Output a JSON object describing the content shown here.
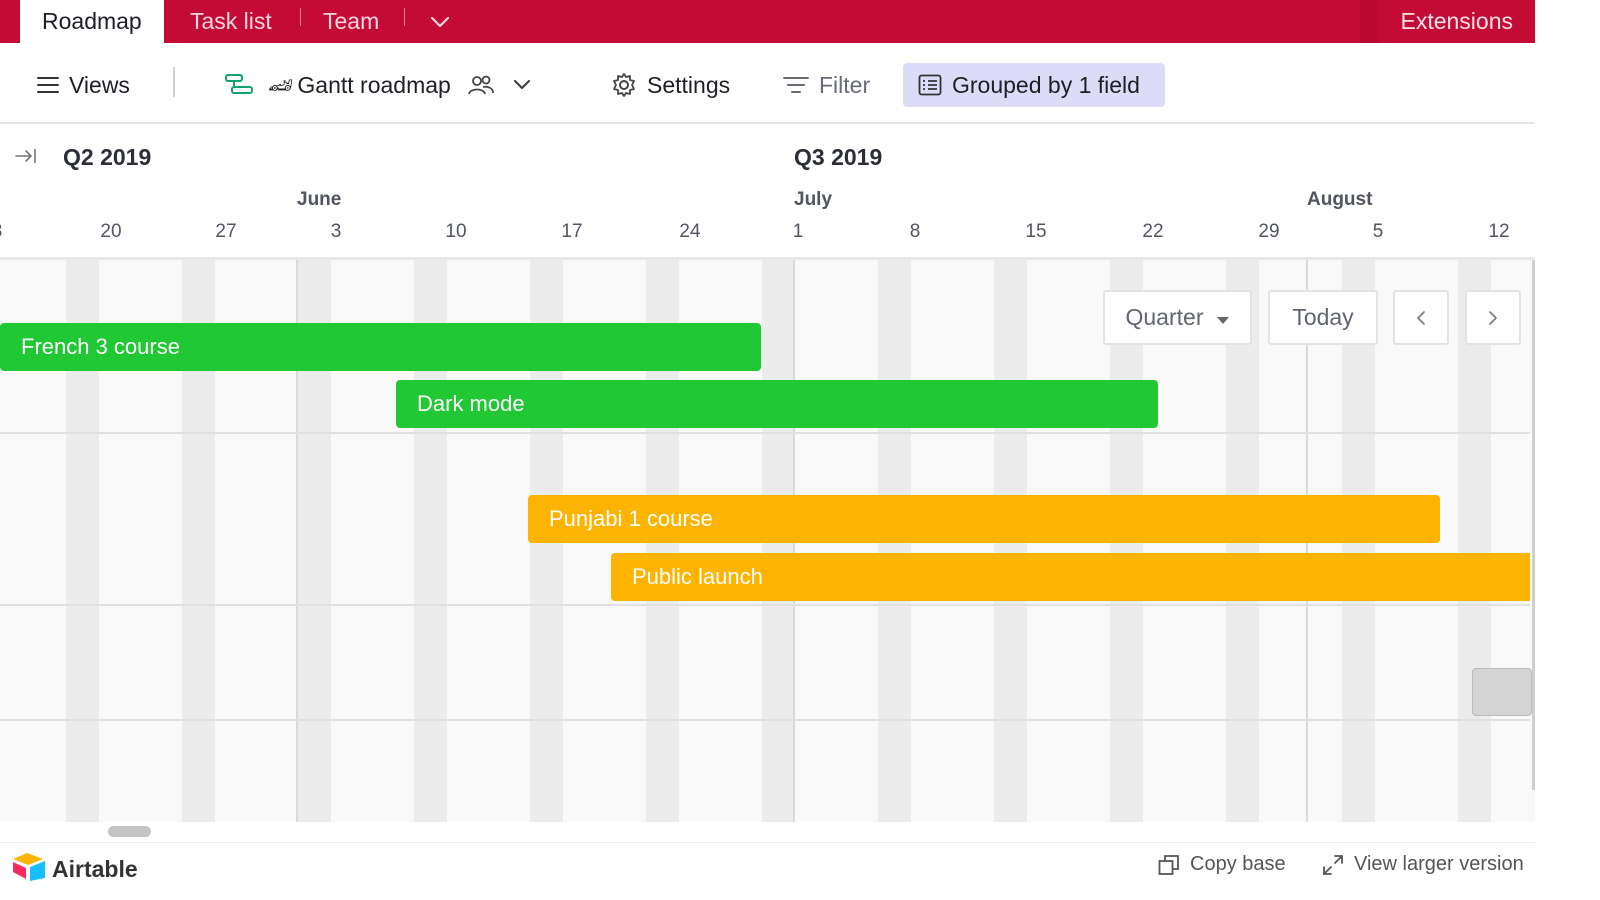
{
  "tabs": {
    "roadmap": "Roadmap",
    "task_list": "Task list",
    "team": "Team",
    "extensions": "Extensions"
  },
  "toolbar": {
    "views": "Views",
    "view_emoji": "🏎",
    "view_name": "Gantt roadmap",
    "settings": "Settings",
    "filter": "Filter",
    "grouped": "Grouped by 1 field"
  },
  "timeline": {
    "quarters": [
      "Q2 2019",
      "Q3 2019"
    ],
    "months": [
      "June",
      "July",
      "August"
    ],
    "days": [
      "3",
      "20",
      "27",
      "3",
      "10",
      "17",
      "24",
      "1",
      "8",
      "15",
      "22",
      "29",
      "5",
      "12"
    ]
  },
  "bars": [
    {
      "label": "French 3 course",
      "group": "green",
      "start": "2019-05-13",
      "end": "2019-06-30"
    },
    {
      "label": "Dark mode",
      "group": "green",
      "start": "2019-06-09",
      "end": "2019-07-27"
    },
    {
      "label": "Punjabi 1 course",
      "group": "orange",
      "start": "2019-06-18",
      "end": "2019-08-07"
    },
    {
      "label": "Public launch",
      "group": "orange",
      "start": "2019-06-23"
    }
  ],
  "controls": {
    "range": "Quarter",
    "today": "Today",
    "prev": "‹",
    "next": "›"
  },
  "footer": {
    "brand": "Airtable",
    "copy_base": "Copy base",
    "view_larger": "View larger version"
  },
  "colors": {
    "header": "#c40b35",
    "green": "#20c933",
    "orange": "#fcb400",
    "grouped_bg": "#dcdcf8"
  }
}
